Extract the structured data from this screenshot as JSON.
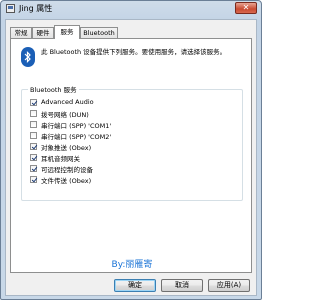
{
  "window": {
    "title": "Jing 属性",
    "close_label": "✕"
  },
  "tabs": [
    "常规",
    "硬件",
    "服务",
    "Bluetooth"
  ],
  "active_tab": 2,
  "description": "此 Bluetooth 设备提供下列服务。要使用服务，请选择该服务。",
  "services_group": {
    "label": "Bluetooth 服务",
    "items": [
      {
        "label": "Advanced Audio",
        "checked": true
      },
      {
        "label": "拨号网络 (DUN)",
        "checked": false
      },
      {
        "label": "串行端口 (SPP) 'COM1'",
        "checked": false
      },
      {
        "label": "串行端口 (SPP) 'COM2'",
        "checked": false
      },
      {
        "label": "对象推送 (Obex)",
        "checked": true
      },
      {
        "label": "耳机音频网关",
        "checked": true
      },
      {
        "label": "可远程控制的设备",
        "checked": true
      },
      {
        "label": "文件传送 (Obex)",
        "checked": true
      }
    ]
  },
  "watermark": "By:丽雁寄",
  "buttons": {
    "ok": "确定",
    "cancel": "取消",
    "apply": "应用(A)"
  },
  "icons": {
    "bluetooth": "bluetooth-icon",
    "app": "window-app-icon",
    "close": "close-icon"
  }
}
